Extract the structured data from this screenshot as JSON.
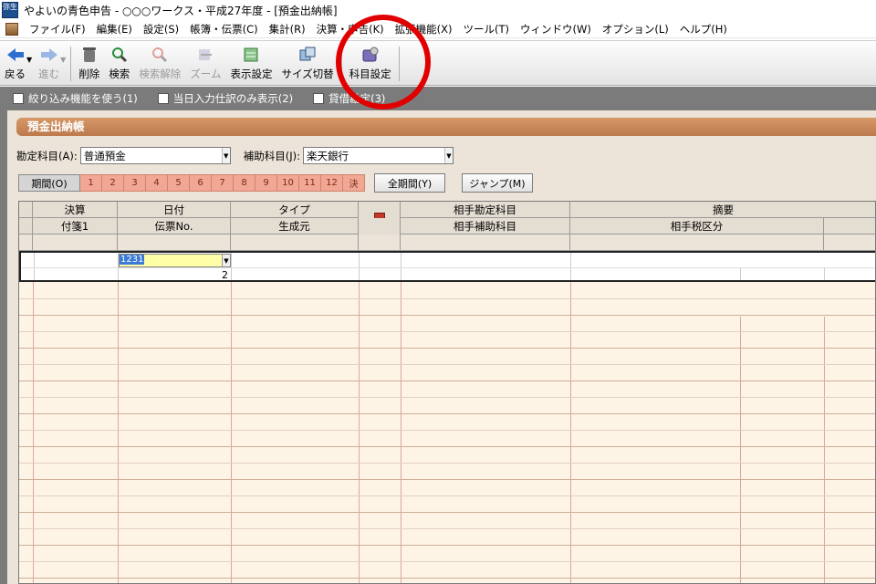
{
  "window": {
    "app_icon_text": "弥生",
    "title": "やよいの青色申告 - ○○○ワークス・平成27年度 - [預金出納帳]"
  },
  "menu": {
    "items": [
      "ファイル(F)",
      "編集(E)",
      "設定(S)",
      "帳簿・伝票(C)",
      "集計(R)",
      "決算・申告(K)",
      "拡張機能(X)",
      "ツール(T)",
      "ウィンドウ(W)",
      "オプション(L)",
      "ヘルプ(H)"
    ]
  },
  "toolbar": {
    "back": "戻る",
    "forward": "進む",
    "delete": "削除",
    "search": "検索",
    "clear_search": "検索解除",
    "zoom": "ズーム",
    "display_settings": "表示設定",
    "size_switch": "サイズ切替",
    "account_settings": "科目設定"
  },
  "options": {
    "filter": "絞り込み機能を使う(1)",
    "today_only": "当日入力仕訳のみ表示(2)",
    "lending": "貸借勘定(3)"
  },
  "panel": {
    "title": "預金出納帳"
  },
  "fields": {
    "account_label": "勘定科目(A):",
    "account_value": "普通預金",
    "sub_account_label": "補助科目(J):",
    "sub_account_value": "楽天銀行"
  },
  "period": {
    "label": "期間(O)",
    "months": [
      "1",
      "2",
      "3",
      "4",
      "5",
      "6",
      "7",
      "8",
      "9",
      "10",
      "11",
      "12",
      "決"
    ],
    "all_period_button": "全期間(Y)",
    "jump_button": "ジャンプ(M)"
  },
  "grid": {
    "headers_row1": [
      "決算",
      "日付",
      "タイプ",
      "",
      "相手勘定科目",
      "摘要"
    ],
    "headers_row2": [
      "付箋1",
      "伝票No.",
      "生成元",
      "",
      "相手補助科目",
      "相手税区分"
    ],
    "active_row": {
      "date_value": "1231",
      "slip_no": "2"
    }
  },
  "colors": {
    "panel_title": "#c8845a",
    "period_buttons": "#f1a793",
    "grid_background": "#fdf4e5",
    "annotation_circle": "#e10000",
    "date_input_bg": "#ffffa8"
  }
}
